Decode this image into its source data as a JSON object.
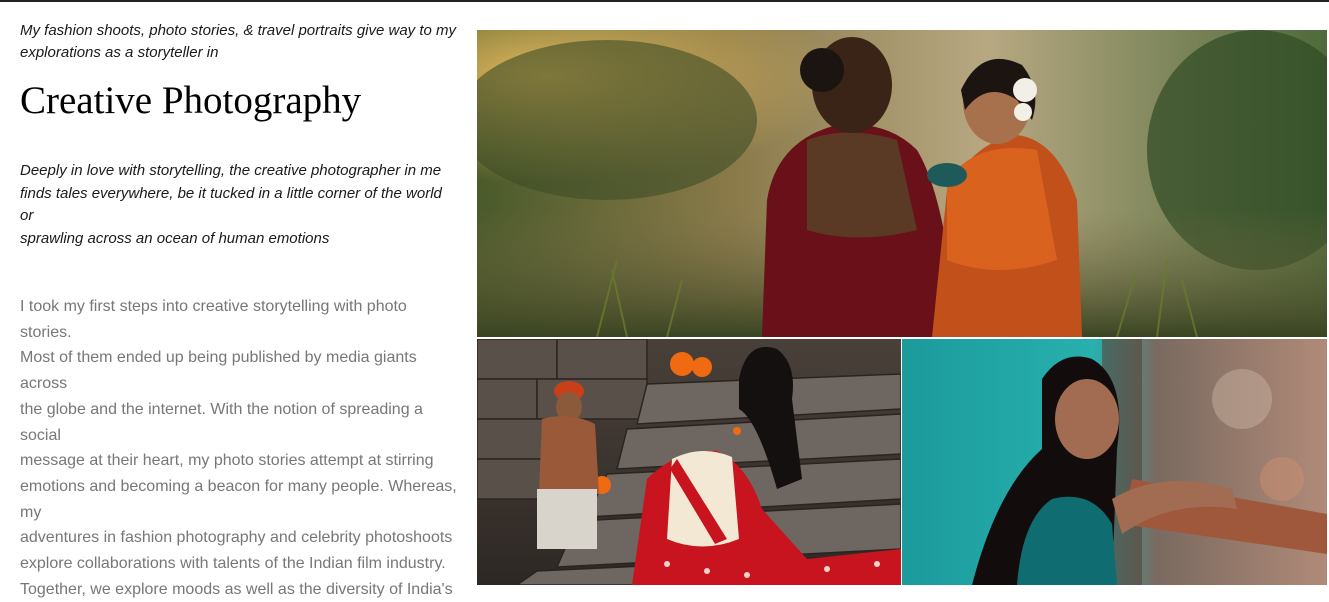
{
  "intro": {
    "lines": [
      "My fashion shoots, photo stories, & travel portraits give way to my",
      "explorations as a storyteller in"
    ]
  },
  "title": "Creative Photography",
  "tagline": {
    "lines": [
      "Deeply in love with storytelling, the creative photographer in me",
      "finds tales everywhere, be it tucked in a little corner of the world",
      "or",
      "sprawling across an ocean of human emotions"
    ]
  },
  "body": {
    "lines": [
      "I took my first steps into creative storytelling with photo",
      "stories.",
      "Most of them ended up being published by media giants",
      "across",
      "the globe and the internet. With the notion of spreading a",
      "social",
      "message at their heart, my photo stories attempt at stirring",
      "emotions and becoming a beacon for many people. Whereas,",
      "my",
      "adventures in fashion photography and celebrity photoshoots",
      "explore collaborations with talents of the Indian film industry.",
      "Together, we explore moods as well as the diversity of India's"
    ]
  },
  "colors": {
    "heading": "#000000",
    "italic_text": "#1a1a1a",
    "body_text": "#777777",
    "top_rule": "#222222"
  }
}
